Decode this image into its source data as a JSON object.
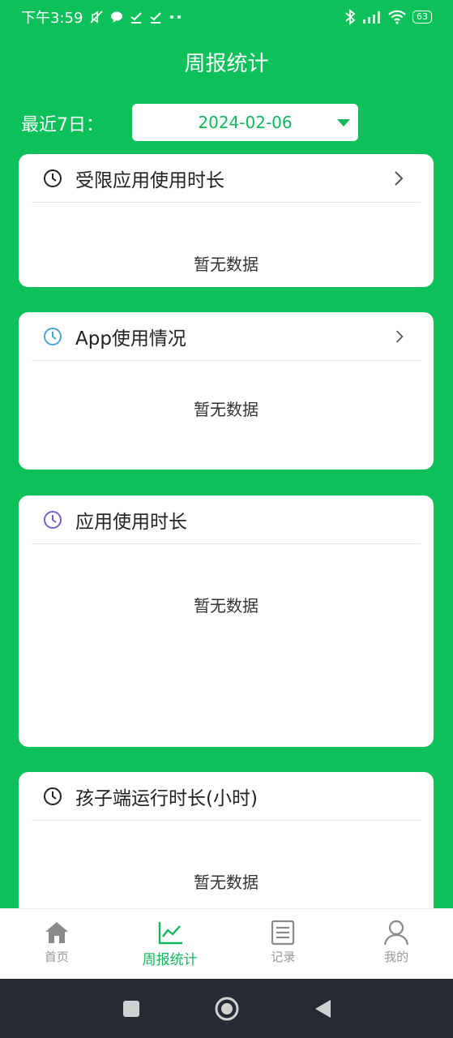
{
  "status_bar": {
    "time": "下午3:59",
    "battery": "63"
  },
  "header": {
    "title": "周报统计"
  },
  "date_filter": {
    "label": "最近7日：",
    "value": "2024-02-06"
  },
  "cards": [
    {
      "title": "受限应用使用时长",
      "empty_text": "暂无数据",
      "icon": "clock-icon",
      "icon_color": "#222222"
    },
    {
      "title": "App使用情况",
      "empty_text": "暂无数据",
      "icon": "clock-icon",
      "icon_color": "#4aa3d8"
    },
    {
      "title": "应用使用时长",
      "empty_text": "暂无数据",
      "icon": "clock-icon",
      "icon_color": "#7b5fc7"
    },
    {
      "title": "孩子端运行时长(小时)",
      "empty_text": "暂无数据",
      "icon": "clock-icon",
      "icon_color": "#222222"
    }
  ],
  "bottom_nav": {
    "items": [
      {
        "label": "首页",
        "icon": "home-icon"
      },
      {
        "label": "周报统计",
        "icon": "chart-icon"
      },
      {
        "label": "记录",
        "icon": "list-icon"
      },
      {
        "label": "我的",
        "icon": "user-icon"
      }
    ],
    "active_index": 1
  },
  "colors": {
    "primary": "#0dc15a",
    "accent_text": "#12b85a",
    "system_bar": "#262a35"
  }
}
